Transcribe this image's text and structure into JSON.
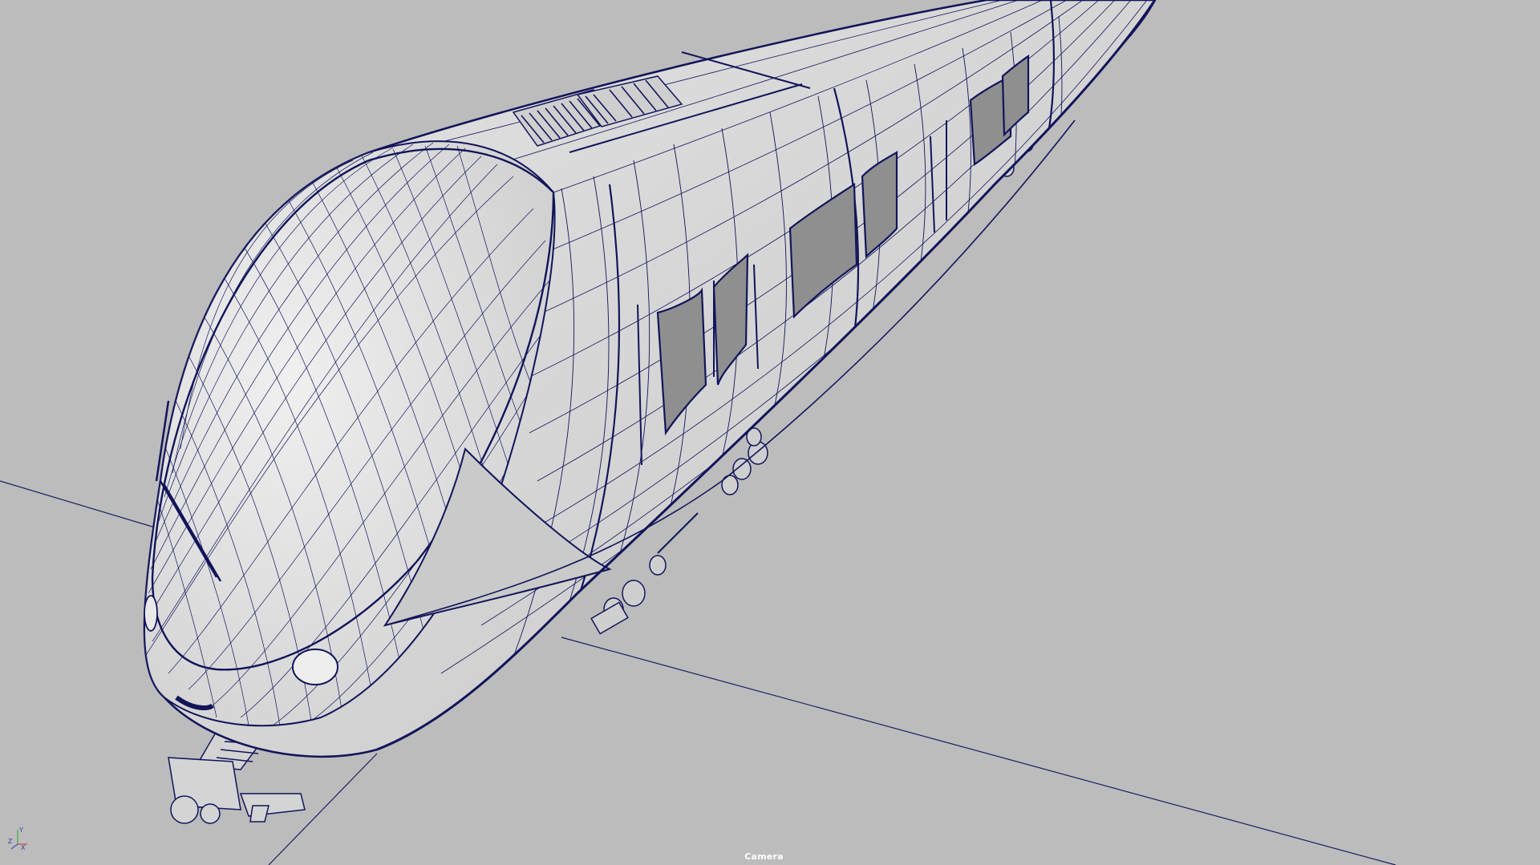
{
  "app": {
    "viewport_name": "Camera"
  },
  "viewport": {
    "background_color": "#bcbcbc",
    "wireframe_color": "#12145a",
    "shaded_color": "#d9d9d9",
    "window_glass_color": "#8a8a8a",
    "display_mode": "wireframe-on-shaded"
  },
  "scene": {
    "object": "train-model"
  },
  "axis_gizmo": {
    "x_label": "X",
    "y_label": "Y",
    "z_label": "Z",
    "x_color": "#c84040",
    "y_color": "#40b040",
    "z_color": "#4050c8"
  }
}
